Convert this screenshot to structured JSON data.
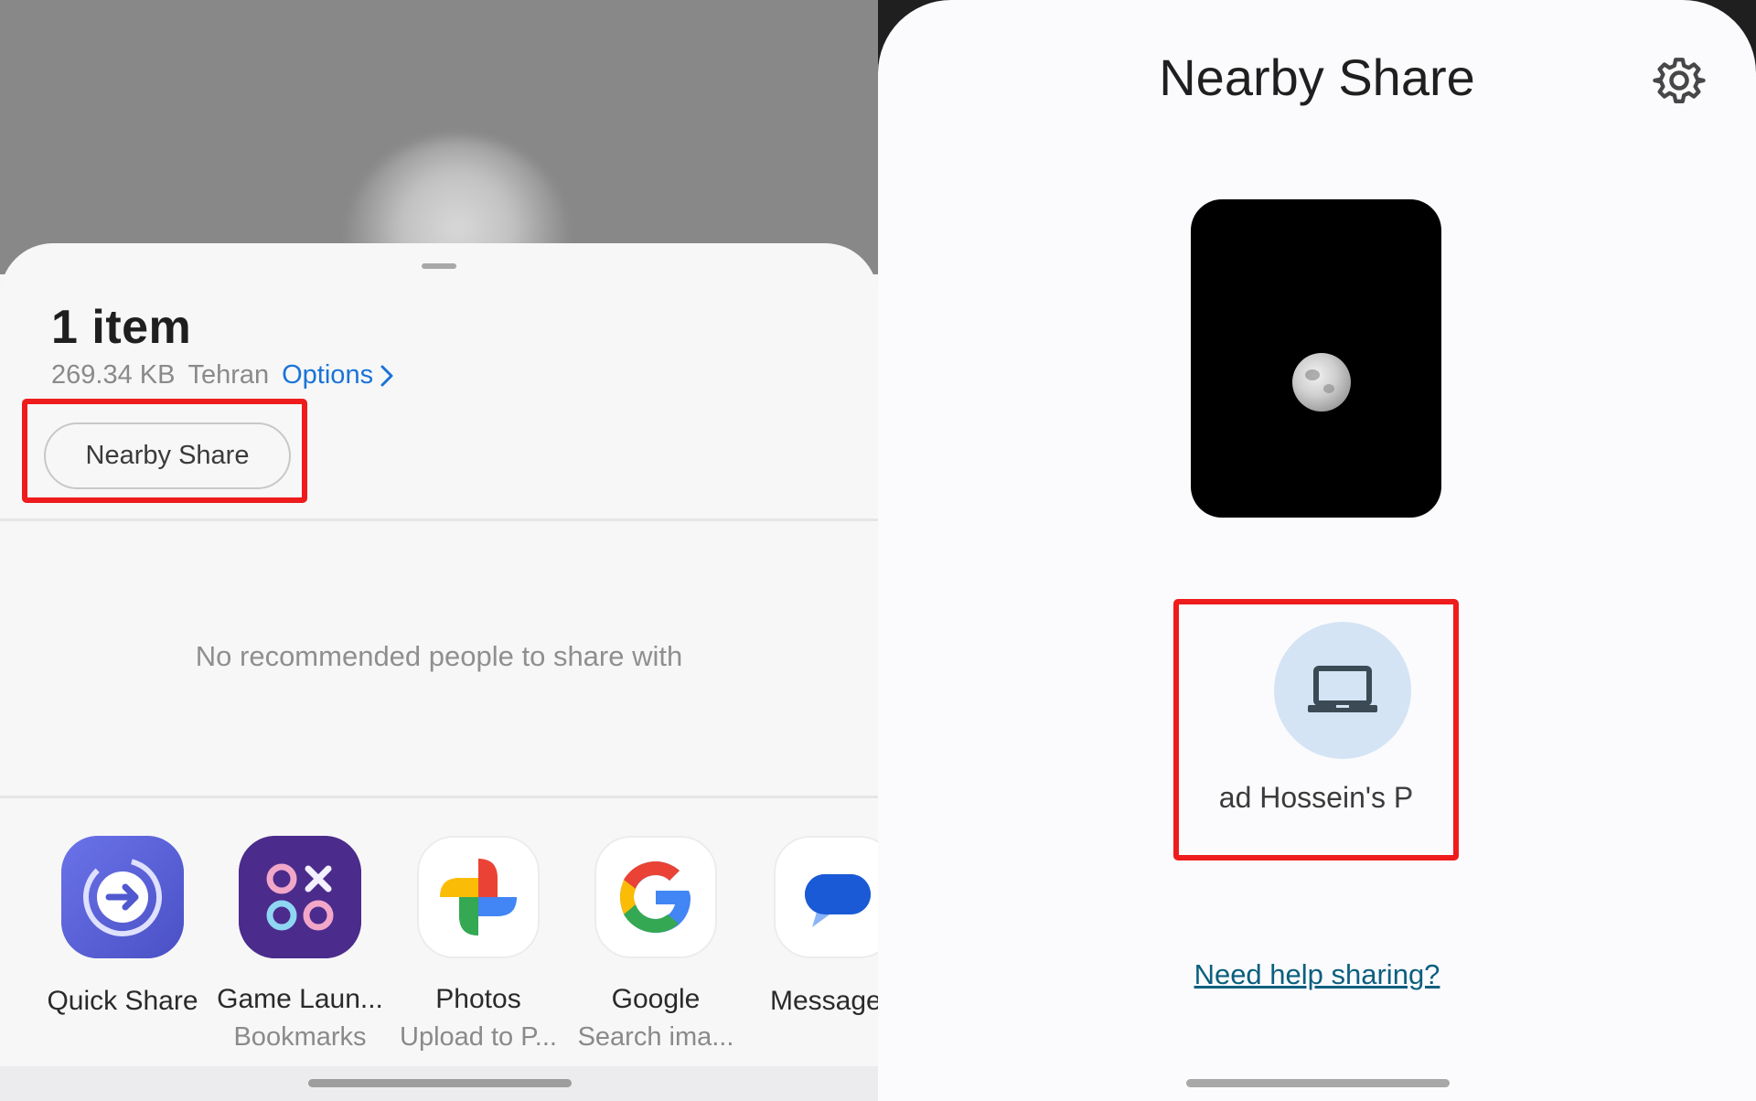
{
  "share_sheet": {
    "item_count": "1 item",
    "file_size": "269.34 KB",
    "location": "Tehran",
    "options_label": "Options",
    "nearby_share_chip": "Nearby Share",
    "empty_people_text": "No recommended people to share with",
    "apps": [
      {
        "label": "Quick Share",
        "sub": "",
        "icon": "quick-share-icon"
      },
      {
        "label": "Game Laun...",
        "sub": "Bookmarks",
        "icon": "game-launcher-icon"
      },
      {
        "label": "Photos",
        "sub": "Upload to P...",
        "icon": "google-photos-icon"
      },
      {
        "label": "Google",
        "sub": "Search ima...",
        "icon": "google-icon"
      },
      {
        "label": "Message",
        "sub": "",
        "icon": "messages-icon"
      }
    ]
  },
  "nearby_share": {
    "title": "Nearby Share",
    "settings_icon": "gear-icon",
    "preview_icon": "moon-photo-thumbnail",
    "device_name": "ad Hossein's P",
    "device_icon": "laptop-icon",
    "help_link": "Need help sharing?"
  },
  "colors": {
    "highlight_red": "#ee1c1c",
    "options_blue": "#1a73d6",
    "device_avatar_bg": "#d4e4f4",
    "help_link_color": "#0b5f7e"
  }
}
